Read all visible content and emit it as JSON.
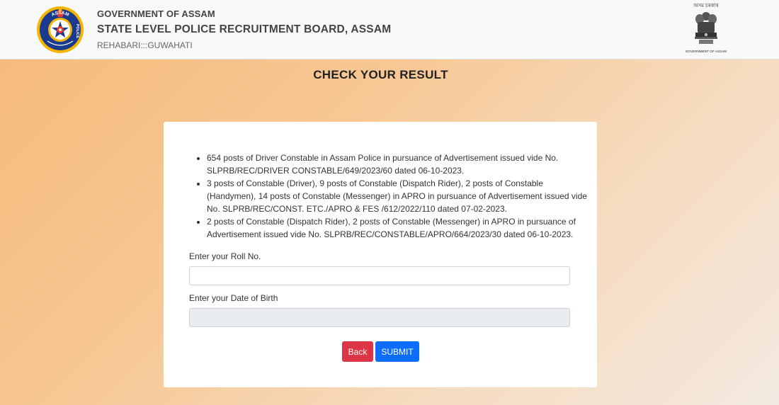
{
  "header": {
    "government": "GOVERNMENT OF ASSAM",
    "board": "STATE LEVEL POLICE RECRUITMENT BOARD, ASSAM",
    "location": "REHABARI:::GUWAHATI",
    "logo_text_top": "ASSAM",
    "logo_text_side": "POLICE",
    "emblem_top": "অসম চৰকাৰ",
    "emblem_bottom": "GOVERNMENT OF ASSAM"
  },
  "page": {
    "title": "CHECK YOUR RESULT"
  },
  "notices": [
    "654 posts of Driver Constable in Assam Police in pursuance of Advertisement issued vide No. SLPRB/REC/DRIVER CONSTABLE/649/2023/60 dated 06-10-2023.",
    "3 posts of Constable (Driver), 9 posts of Constable (Dispatch Rider), 2 posts of Constable (Handymen), 14 posts of Constable (Messenger) in APRO in pursuance of Advertisement issued vide No. SLPRB/REC/CONST. ETC./APRO & FES /612/2022/110 dated 07-02-2023.",
    "2 posts of Constable (Dispatch Rider), 2 posts of Constable (Messenger) in APRO in pursuance of Advertisement issued vide No. SLPRB/REC/CONSTABLE/APRO/664/2023/30 dated 06-10-2023."
  ],
  "form": {
    "roll_label": "Enter your Roll No.",
    "roll_value": "",
    "dob_label": "Enter your Date of Birth",
    "dob_value": "",
    "back_label": "Back",
    "submit_label": "SUBMIT"
  },
  "colors": {
    "back_button": "#dc3545",
    "submit_button": "#0d6efd",
    "logo_ring": "#1a3a8f",
    "logo_accent": "#e33b2f"
  }
}
